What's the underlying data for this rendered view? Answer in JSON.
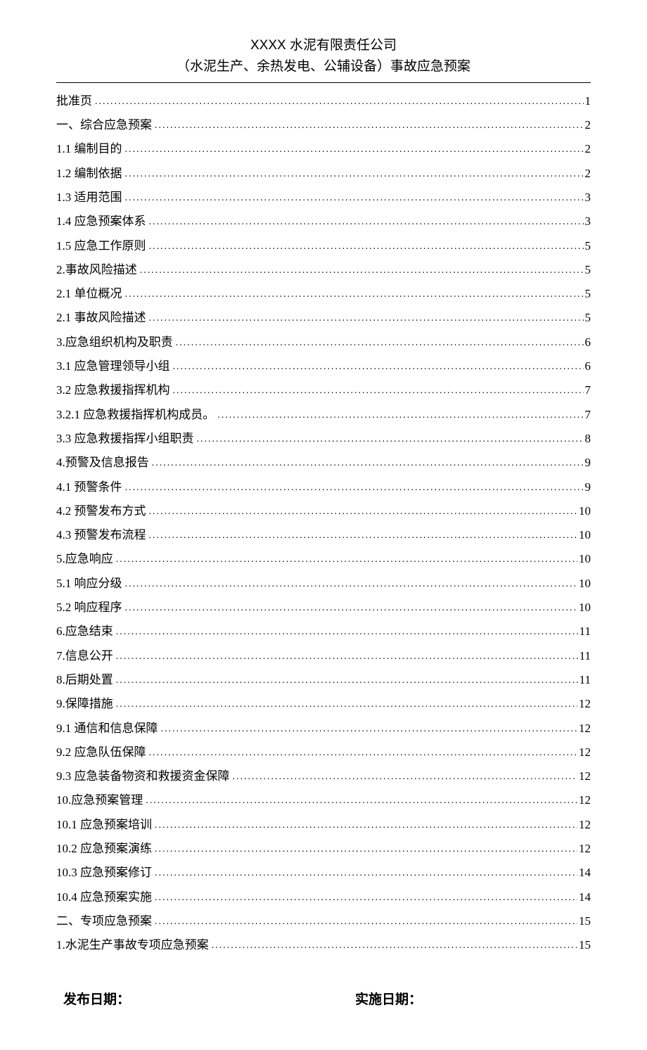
{
  "header": {
    "title": "XXXX 水泥有限责任公司",
    "subtitle": "（水泥生产、余热发电、公辅设备）事故应急预案"
  },
  "toc": [
    {
      "label": "批准页",
      "page": "1"
    },
    {
      "label": "一、综合应急预案",
      "page": "2"
    },
    {
      "label": "1.1 编制目的",
      "page": "2"
    },
    {
      "label": "1.2 编制依据",
      "page": "2"
    },
    {
      "label": "1.3 适用范围",
      "page": "3"
    },
    {
      "label": "1.4 应急预案体系",
      "page": "3"
    },
    {
      "label": "1.5 应急工作原则",
      "page": "5"
    },
    {
      "label": "2.事故风险描述",
      "page": "5"
    },
    {
      "label": "2.1 单位概况",
      "page": "5"
    },
    {
      "label": "2.1 事故风险描述",
      "page": "5"
    },
    {
      "label": "3.应急组织机构及职责",
      "page": "6"
    },
    {
      "label": "3.1 应急管理领导小组",
      "page": "6"
    },
    {
      "label": "3.2 应急救援指挥机构",
      "page": "7"
    },
    {
      "label": "3.2.1 应急救援指挥机构成员。",
      "page": "7"
    },
    {
      "label": "3.3 应急救援指挥小组职责",
      "page": "8"
    },
    {
      "label": "4.预警及信息报告",
      "page": "9"
    },
    {
      "label": "4.1 预警条件",
      "page": "9"
    },
    {
      "label": "4.2 预警发布方式",
      "page": "10"
    },
    {
      "label": "4.3 预警发布流程",
      "page": "10"
    },
    {
      "label": "5.应急响应",
      "page": "10"
    },
    {
      "label": "5.1 响应分级",
      "page": "10"
    },
    {
      "label": "5.2 响应程序",
      "page": "10"
    },
    {
      "label": "6.应急结束",
      "page": "11"
    },
    {
      "label": "7.信息公开",
      "page": "11"
    },
    {
      "label": "8.后期处置",
      "page": "11"
    },
    {
      "label": "9.保障措施",
      "page": "12"
    },
    {
      "label": "9.1 通信和信息保障",
      "page": "12"
    },
    {
      "label": "9.2 应急队伍保障",
      "page": "12"
    },
    {
      "label": "9.3 应急装备物资和救援资金保障",
      "page": "12"
    },
    {
      "label": "10.应急预案管理",
      "page": "12"
    },
    {
      "label": "10.1 应急预案培训",
      "page": "12"
    },
    {
      "label": "10.2 应急预案演练",
      "page": "12"
    },
    {
      "label": "10.3 应急预案修订",
      "page": "14"
    },
    {
      "label": "10.4 应急预案实施",
      "page": "14"
    },
    {
      "label": "二、专项应急预案",
      "page": "15"
    },
    {
      "label": "1.水泥生产事故专项应急预案",
      "page": "15"
    }
  ],
  "footer": {
    "publish_label": "发布日期：",
    "implement_label": "实施日期："
  }
}
